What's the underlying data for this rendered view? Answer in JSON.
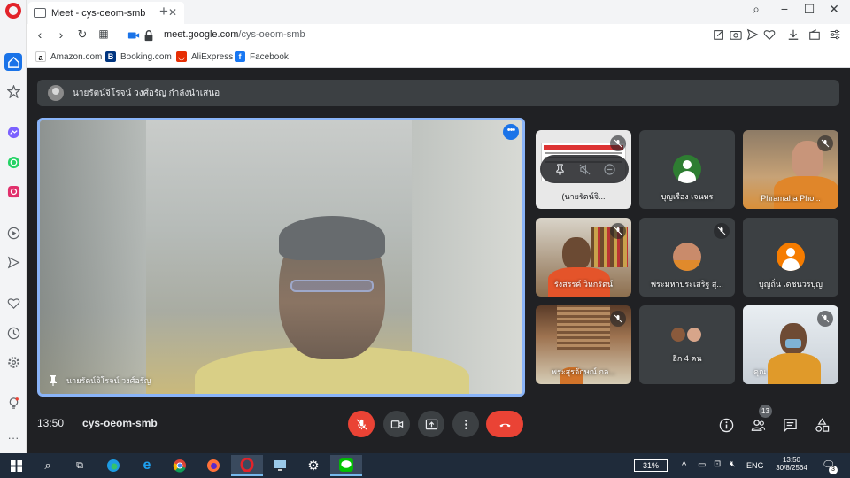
{
  "browser": {
    "tab_title": "Meet - cys-oeom-smb",
    "url_domain": "meet.google.com",
    "url_path": "/cys-oeom-smb",
    "bookmarks": [
      "Amazon.com",
      "Booking.com",
      "AliExpress",
      "Facebook"
    ]
  },
  "meet": {
    "presenting_text": "นายรัตน์จิโรจน์ วงศ์อรัญ กำลังนำเสนอ",
    "main_speaker_name": "นายรัตน์จิโรจน์ วงศ์อรัญ",
    "participants": [
      {
        "name": "(นายรัตน์จิ...",
        "muted": true
      },
      {
        "name": "บุญเรือง เจนทร",
        "muted": false
      },
      {
        "name": "Phramaha Pho...",
        "muted": true
      },
      {
        "name": "รังสรรค์ วิหกรัตน์",
        "muted": true
      },
      {
        "name": "พระมหาประเสริฐ สุ...",
        "muted": true
      },
      {
        "name": "บุญถิ่น เดชนวรบุญ",
        "muted": false
      },
      {
        "name": "พระสุรจักษณ์ กล...",
        "muted": true
      },
      {
        "name": "อีก 4 คน",
        "muted": false
      },
      {
        "name": "คุณ",
        "muted": true
      }
    ],
    "time": "13:50",
    "meeting_code": "cys-oeom-smb",
    "people_count": "13"
  },
  "taskbar": {
    "battery": "31%",
    "language": "ENG",
    "clock_time": "13:50",
    "clock_date": "30/8/2564",
    "notifications": "3"
  },
  "colors": {
    "accent": "#8ab4f8",
    "end_call": "#ea4335",
    "meet_bg": "#202124",
    "tile_bg": "#3c4043"
  }
}
